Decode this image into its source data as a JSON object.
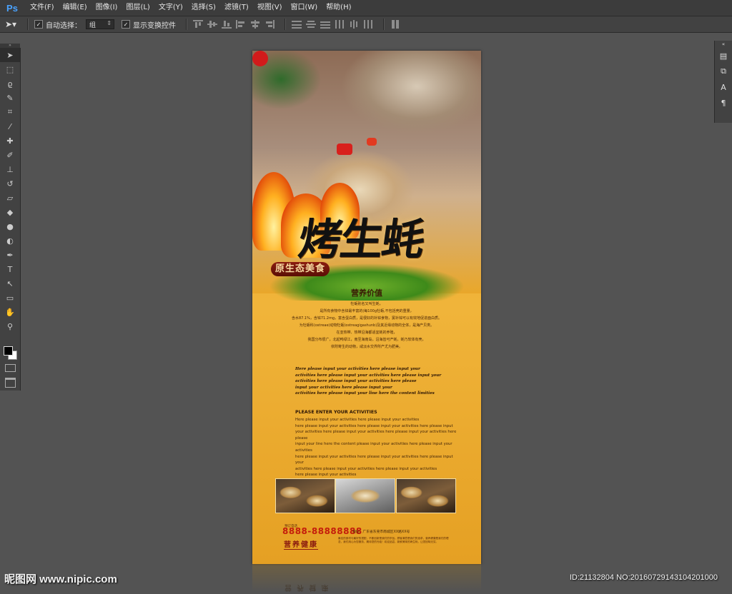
{
  "app": {
    "logo": "Ps"
  },
  "menu": [
    "文件(F)",
    "编辑(E)",
    "图像(I)",
    "图层(L)",
    "文字(Y)",
    "选择(S)",
    "滤镜(T)",
    "视图(V)",
    "窗口(W)",
    "帮助(H)"
  ],
  "options": {
    "auto_select_label": "自动选择：",
    "auto_select_value": "组",
    "show_transform_label": "显示变换控件"
  },
  "tools": [
    "move-icon",
    "marquee-icon",
    "lasso-icon",
    "quick-select-icon",
    "crop-icon",
    "eyedropper-icon",
    "healing-brush-icon",
    "brush-icon",
    "clone-stamp-icon",
    "history-brush-icon",
    "eraser-icon",
    "paint-bucket-icon",
    "blur-icon",
    "dodge-icon",
    "pen-icon",
    "type-icon",
    "path-select-icon",
    "rectangle-icon",
    "hand-icon",
    "zoom-icon"
  ],
  "colors": {
    "foreground": "#000000",
    "background": "#ffffff",
    "canvas_bg": "#e8a326"
  },
  "poster": {
    "title": "烤生蚝",
    "subtitle": "原生态美食",
    "heading": "营养价值",
    "body_lines": [
      "牡蛎别名又叫生蚝，",
      "是所有食物中含锌最丰富的(每100g牡蛎,不包括壳的重量，",
      "含水87.1%，含锌71.2mg，富含蛋白质，是很好的补锌食物，窦补锌可以有效地促进面白质。",
      "为牡蛎科(ostreae)动物牡蛎(ostreagigashunb)及其近缘动物的全体，是海产贝类。",
      "在亚热带、热带沿海都适宜蚝的养殖，",
      "我国分布很广，北起鸭绿江，南至海南岛，沿海皆可产蚝。蚝乃软体有壳，",
      "依附寄生的动物，咸淡水交界所产尤为肥美。"
    ],
    "script_lines": [
      "Here please input your activities here please input your",
      "activities here please input your activities here please input your",
      "activities here please input your activities here please",
      "input your activities here please input your",
      "activities here please input your line here the content limities"
    ],
    "please_heading": "PLEASE ENTER YOUR ACTIVITIES",
    "please_lines": [
      "Here please input your activities here please input your activities",
      "here please input your activities here please input your activities here please input",
      "your activities here please input your activities here please input your activities here please",
      "input your line here the content please input your activities here please input your activities",
      "here please input your activities here please input your activities here please input your",
      "activities here please input your activities here please input your activities",
      "here please input your activities"
    ],
    "phone_label": "预订电话",
    "phone": "8888-88888888",
    "address": "地址：广东省东莞市南城区XX路XX号",
    "health": "营养健康",
    "fine_print": "最佳的食材与最好的搭配，不断创新是我们的宗旨。顾客满意是我们的追求，营养健康是我们的理念，我们用心为您服务，期待您的光临！欢迎品尝，新鲜美味的烤生蚝，让您回味无穷。",
    "reflection_text": "营 养 健 康"
  },
  "watermark": {
    "left": "昵图网 www.nipic.com",
    "right": "ID:21132804 NO:20160729143104201000"
  }
}
